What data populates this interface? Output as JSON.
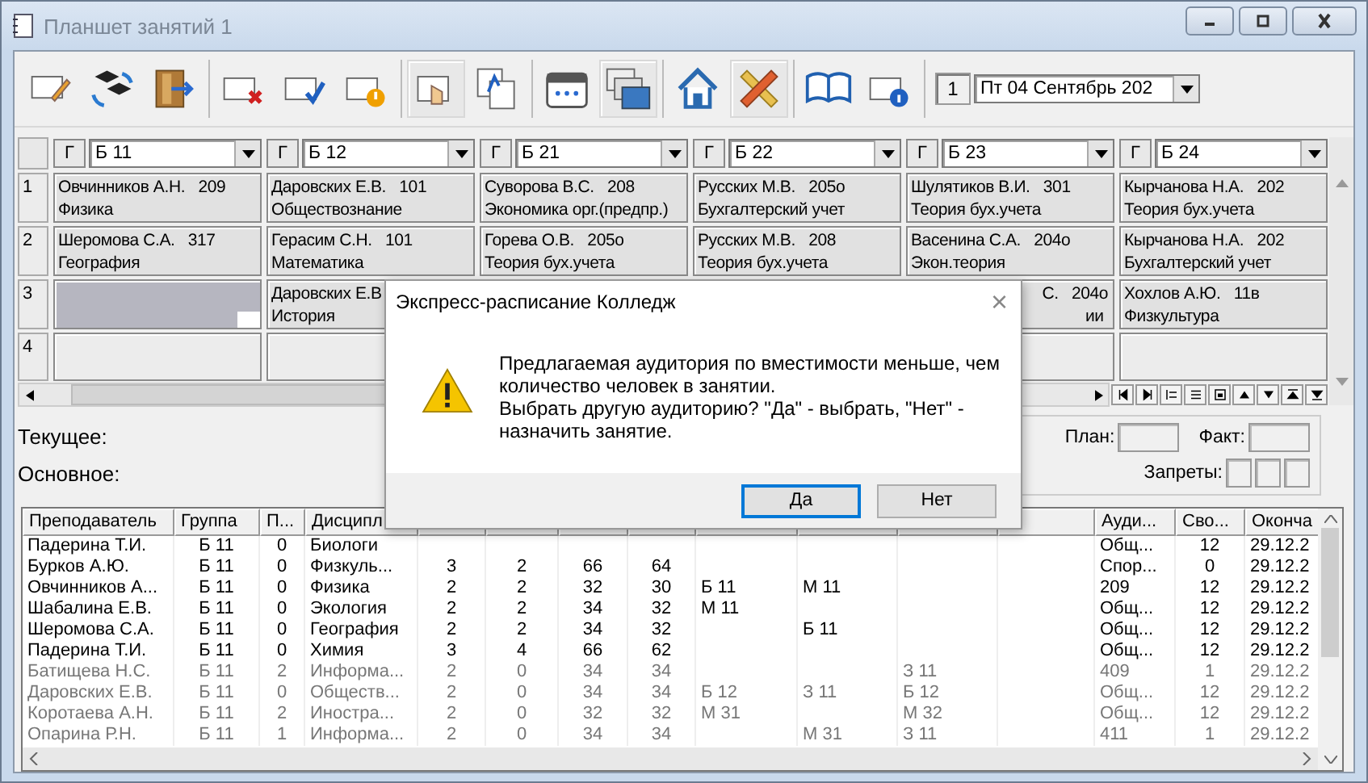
{
  "window": {
    "title": "Планшет занятий 1"
  },
  "toolbar": [
    {
      "buttons": [
        {
          "pressed": false
        },
        {
          "pressed": false
        },
        {
          "pressed": false
        }
      ]
    },
    {
      "buttons": [
        {
          "pressed": false
        },
        {
          "pressed": false
        },
        {
          "pressed": false
        }
      ]
    },
    {
      "buttons": [
        {
          "pressed": true
        },
        {
          "pressed": false
        }
      ]
    },
    {
      "buttons": [
        {
          "pressed": false
        },
        {
          "pressed": true
        }
      ]
    },
    {
      "buttons": [
        {
          "pressed": false
        },
        {
          "pressed": true
        }
      ]
    },
    {
      "buttons": [
        {
          "pressed": false
        },
        {
          "pressed": false
        }
      ]
    }
  ],
  "day_number": "1",
  "date": "Пт 04 Сентябрь 202",
  "grid": {
    "columns": [
      {
        "toggle": "Г",
        "group": "Б 11"
      },
      {
        "toggle": "Г",
        "group": "Б 12"
      },
      {
        "toggle": "Г",
        "group": "Б 21"
      },
      {
        "toggle": "Г",
        "group": "Б 22"
      },
      {
        "toggle": "Г",
        "group": "Б 23"
      },
      {
        "toggle": "Г",
        "group": "Б 24"
      }
    ],
    "rows": [
      {
        "number": "1",
        "cells": [
          {
            "lines": [
              "Овчинников А.Н.   209",
              "Физика"
            ],
            "selected": false
          },
          {
            "lines": [
              "Даровских Е.В.   101",
              "Обществознание"
            ],
            "selected": false
          },
          {
            "lines": [
              "Суворова В.С.   208",
              "Экономика орг.(предпр.)"
            ],
            "selected": false
          },
          {
            "lines": [
              "Русских М.В.   205о",
              "Бухгалтерский учет"
            ],
            "selected": false
          },
          {
            "lines": [
              "Шулятиков В.И.   301",
              "Теория бух.учета"
            ],
            "selected": false
          },
          {
            "lines": [
              "Кырчанова Н.А.   202",
              "Теория бух.учета"
            ],
            "selected": false
          }
        ]
      },
      {
        "number": "2",
        "cells": [
          {
            "lines": [
              "Шеромова С.А.   317",
              "География"
            ],
            "selected": false
          },
          {
            "lines": [
              "Герасим С.Н.   101",
              "Математика"
            ],
            "selected": false
          },
          {
            "lines": [
              "Горева О.В.   205о",
              "Теория бух.учета"
            ],
            "selected": false
          },
          {
            "lines": [
              "Русских М.В.   208",
              "Теория бух.учета"
            ],
            "selected": false
          },
          {
            "lines": [
              "Васенина С.А.   204о",
              "Экон.теория"
            ],
            "selected": false
          },
          {
            "lines": [
              "Кырчанова Н.А.   202",
              "Бухгалтерский учет"
            ],
            "selected": false
          }
        ]
      },
      {
        "number": "3",
        "cells": [
          {
            "selected": true
          },
          {
            "lines": [
              "Даровских Е.В",
              "История"
            ],
            "selected": false
          },
          {},
          {},
          {
            "lines": [
              "С.   204о",
              "ии"
            ],
            "cut_left": true,
            "selected": false
          },
          {
            "lines": [
              "Хохлов А.Ю.   11в",
              "Физкультура"
            ],
            "selected": false
          }
        ]
      },
      {
        "number": "4",
        "cells": [
          {
            "selected": false
          },
          {
            "selected": false
          },
          {},
          {},
          {
            "selected": false
          },
          {
            "selected": false
          }
        ]
      }
    ]
  },
  "info": {
    "current_label": "Текущее:",
    "main_label": "Основное:",
    "plan_label": "План:",
    "fact_label": "Факт:",
    "bans_label": "Запреты:"
  },
  "table": {
    "columns": [
      {
        "label": "Преподаватель"
      },
      {
        "label": "Группа"
      },
      {
        "label": "П..."
      },
      {
        "label": "Дисципл"
      },
      {},
      {},
      {},
      {},
      {},
      {},
      {},
      {},
      {
        "label": "Ауди..."
      },
      {
        "label": "Сво..."
      },
      {
        "label": "Оконча"
      }
    ],
    "rows": [
      {
        "dimmed": false,
        "cells": [
          "Падерина Т.И.",
          "Б 11",
          "0",
          "Биологи",
          null,
          null,
          null,
          null,
          null,
          null,
          null,
          null,
          "Общ...",
          "12",
          "29.12.2"
        ]
      },
      {
        "dimmed": false,
        "cells": [
          "Бурков А.Ю.",
          "Б 11",
          "0",
          "Физкуль...",
          "3",
          "2",
          "66",
          "64",
          null,
          null,
          null,
          null,
          "Спор...",
          "0",
          "29.12.2"
        ]
      },
      {
        "dimmed": false,
        "cells": [
          "Овчинников А...",
          "Б 11",
          "0",
          "Физика",
          "2",
          "2",
          "32",
          "30",
          "Б 11",
          "М 11",
          null,
          null,
          "209",
          "12",
          "29.12.2"
        ]
      },
      {
        "dimmed": false,
        "cells": [
          "Шабалина Е.В.",
          "Б 11",
          "0",
          "Экология",
          "2",
          "2",
          "34",
          "32",
          "М 11",
          null,
          null,
          null,
          "Общ...",
          "12",
          "29.12.2"
        ]
      },
      {
        "dimmed": false,
        "cells": [
          "Шеромова С.А.",
          "Б 11",
          "0",
          "География",
          "2",
          "2",
          "34",
          "32",
          null,
          "Б 11",
          null,
          null,
          "Общ...",
          "12",
          "29.12.2"
        ]
      },
      {
        "dimmed": false,
        "cells": [
          "Падерина Т.И.",
          "Б 11",
          "0",
          "Химия",
          "3",
          "4",
          "66",
          "62",
          null,
          null,
          null,
          null,
          "Общ...",
          "12",
          "29.12.2"
        ]
      },
      {
        "dimmed": true,
        "cells": [
          "Батищева Н.С.",
          "Б 11",
          "2",
          "Информа...",
          "2",
          "0",
          "34",
          "34",
          null,
          null,
          "З 11",
          null,
          "409",
          "1",
          "29.12.2"
        ]
      },
      {
        "dimmed": true,
        "cells": [
          "Даровских Е.В.",
          "Б 11",
          "0",
          "Обществ...",
          "2",
          "0",
          "34",
          "34",
          "Б 12",
          "З 11",
          "Б 12",
          null,
          "Общ...",
          "12",
          "29.12.2"
        ]
      },
      {
        "dimmed": true,
        "cells": [
          "Коротаева А.Н.",
          "Б 11",
          "2",
          "Иностра...",
          "2",
          "0",
          "32",
          "32",
          "М 31",
          null,
          "М 32",
          null,
          "Общ...",
          "12",
          "29.12.2"
        ]
      },
      {
        "dimmed": true,
        "cells": [
          "Опарина Р.Н.",
          "Б 11",
          "1",
          "Информа...",
          "2",
          "0",
          "34",
          "34",
          null,
          "М 31",
          "З 11",
          null,
          "411",
          "1",
          "29.12.2"
        ]
      }
    ]
  },
  "dialog": {
    "title": "Экспресс-расписание Колледж",
    "close": "×",
    "message_lines": [
      "Предлагаемая аудитория по вместимости меньше, чем",
      "количество человек в занятии.",
      "Выбрать другую аудиторию? \"Да\" - выбрать, \"Нет\" -",
      "назначить занятие."
    ],
    "buttons": [
      {
        "label": "Да",
        "default": true
      },
      {
        "label": "Нет",
        "default": false
      }
    ]
  }
}
